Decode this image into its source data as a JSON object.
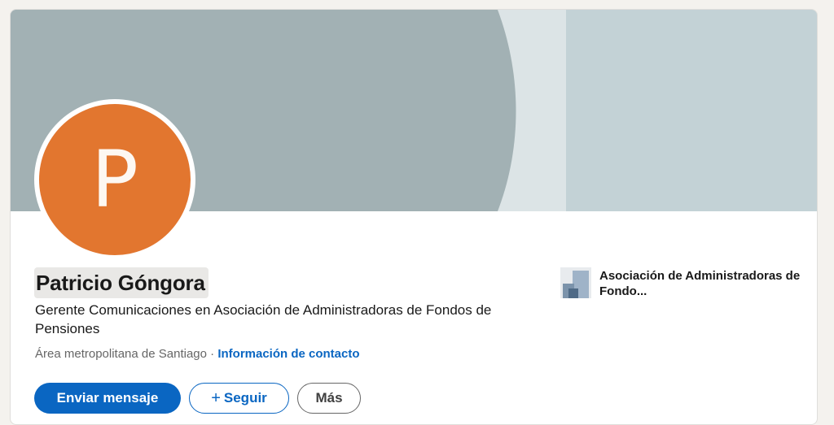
{
  "profile": {
    "avatar_initial": "P",
    "name": "Patricio Góngora",
    "headline": "Gerente Comunicaciones en Asociación de Administradoras de Fondos de Pensiones",
    "location": "Área metropolitana de Santiago",
    "separator": " · ",
    "contact_link": "Información de contacto"
  },
  "actions": {
    "message_label": "Enviar mensaje",
    "follow_label": "Seguir",
    "follow_icon": "+",
    "more_label": "Más"
  },
  "company": {
    "name": "Asociación de Administradoras de Fondo..."
  },
  "colors": {
    "accent": "#0a66c2",
    "avatar_bg": "#e2762f",
    "cover_primary": "#a2b1b4",
    "cover_light": "#dce4e6",
    "cover_right": "#c3d2d6"
  }
}
